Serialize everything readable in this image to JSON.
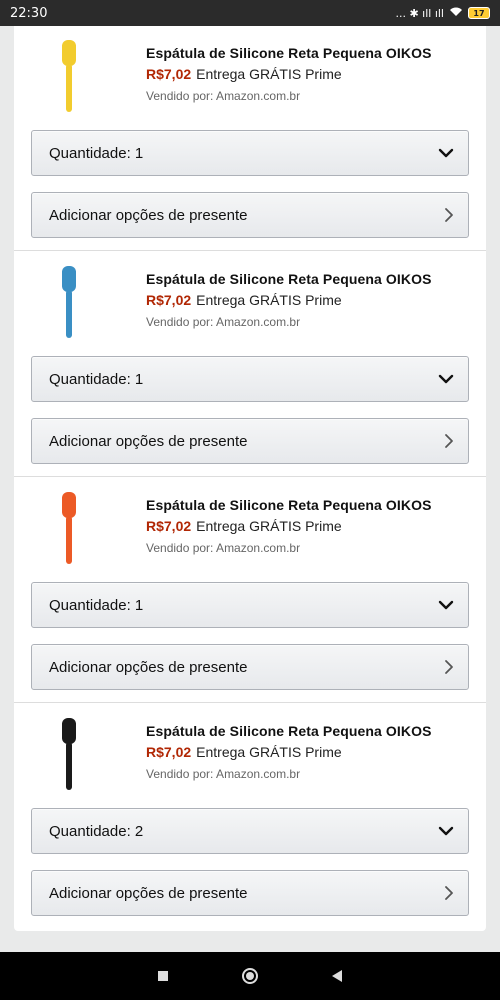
{
  "status_bar": {
    "time": "22:30",
    "indicators": "... ✱ ıll ıll",
    "battery": "17"
  },
  "items": [
    {
      "title": "Espátula de Silicone Reta Pequena OIKOS",
      "price": "R$7,02",
      "delivery": "Entrega GRÁTIS Prime",
      "sold_by": "Vendido por: Amazon.com.br",
      "quantity_label": "Quantidade: 1",
      "gift_label": "Adicionar opções de presente",
      "color": "#f2cc2e"
    },
    {
      "title": "Espátula de Silicone Reta Pequena OIKOS",
      "price": "R$7,02",
      "delivery": "Entrega GRÁTIS Prime",
      "sold_by": "Vendido por: Amazon.com.br",
      "quantity_label": "Quantidade: 1",
      "gift_label": "Adicionar opções de presente",
      "color": "#3a8fc4"
    },
    {
      "title": "Espátula de Silicone Reta Pequena OIKOS",
      "price": "R$7,02",
      "delivery": "Entrega GRÁTIS Prime",
      "sold_by": "Vendido por: Amazon.com.br",
      "quantity_label": "Quantidade: 1",
      "gift_label": "Adicionar opções de presente",
      "color": "#ec5a26"
    },
    {
      "title": "Espátula de Silicone Reta Pequena OIKOS",
      "price": "R$7,02",
      "delivery": "Entrega GRÁTIS Prime",
      "sold_by": "Vendido por: Amazon.com.br",
      "quantity_label": "Quantidade: 2",
      "gift_label": "Adicionar opções de presente",
      "color": "#1a1a1a"
    }
  ],
  "icons": {
    "quantity": "chevron-down-icon",
    "gift": "chevron-right-icon",
    "nav": [
      "square-icon",
      "circle-home-icon",
      "triangle-back-icon"
    ]
  }
}
